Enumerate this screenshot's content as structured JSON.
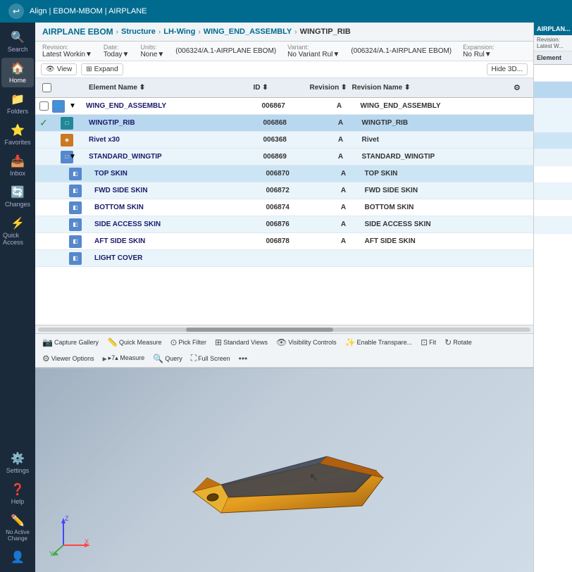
{
  "topbar": {
    "back_label": "←",
    "title": "Align | EBOM-MBOM | AIRPLANE"
  },
  "sidebar": {
    "items": [
      {
        "id": "search",
        "icon": "🔍",
        "label": "Search"
      },
      {
        "id": "home",
        "icon": "🏠",
        "label": "Home"
      },
      {
        "id": "folders",
        "icon": "📁",
        "label": "Folders"
      },
      {
        "id": "favorites",
        "icon": "⭐",
        "label": "Favorites"
      },
      {
        "id": "inbox",
        "icon": "📥",
        "label": "Inbox"
      },
      {
        "id": "changes",
        "icon": "🔄",
        "label": "Changes"
      },
      {
        "id": "quick-access",
        "icon": "⚡",
        "label": "Quick Access"
      }
    ],
    "bottom_items": [
      {
        "id": "settings",
        "icon": "⚙️",
        "label": "Settings"
      },
      {
        "id": "help",
        "icon": "❓",
        "label": "Help"
      },
      {
        "id": "no-active-change",
        "icon": "✏️",
        "label": "No Active Change"
      },
      {
        "id": "user",
        "icon": "👤",
        "label": "User"
      }
    ]
  },
  "ebom": {
    "title": "AIRPLANE EBOM",
    "breadcrumb": [
      "Structure",
      "LH-Wing",
      "WING_END_ASSEMBLY",
      "WINGTIP_RIB"
    ],
    "revision_bar": {
      "revision_label": "Revision:",
      "revision_val": "Latest Workin▼",
      "date_label": "Date:",
      "date_val": "Today▼",
      "units_label": "Units:",
      "units_val": "None▼",
      "ebom_label": "(006324/A.1-AIRPLANE EBOM)",
      "variant_label": "Variant:",
      "variant_val": "No Variant Rul▼",
      "variant2_val": "(006324/A.1-AIRPLANE EBOM)",
      "expansion_label": "Expansion:",
      "expansion_val": "No Rul▼"
    },
    "toolbar": {
      "view_label": "View",
      "expand_label": "Expand",
      "hide3d_label": "Hide 3D..."
    },
    "columns": {
      "element_name": "Element Name ⬍",
      "id": "ID ⬍",
      "revision": "Revision ⬍",
      "revision_name": "Revision Name ⬍"
    },
    "rows": [
      {
        "indent": 0,
        "checked": false,
        "icon": "globe",
        "expand": true,
        "name": "WING_END_ASSEMBLY",
        "id": "006867",
        "rev": "A",
        "rev_name": "WING_END_ASSEMBLY",
        "style": "normal"
      },
      {
        "indent": 1,
        "checked": true,
        "icon": "box",
        "expand": false,
        "name": "WINGTIP_RIB",
        "id": "006868",
        "rev": "A",
        "rev_name": "WINGTIP_RIB",
        "style": "selected"
      },
      {
        "indent": 1,
        "checked": false,
        "icon": "rivet",
        "expand": false,
        "name": "Rivet x30",
        "id": "006368",
        "rev": "A",
        "rev_name": "Rivet",
        "style": "light"
      },
      {
        "indent": 1,
        "checked": false,
        "icon": "box",
        "expand": true,
        "name": "STANDARD_WINGTIP",
        "id": "006869",
        "rev": "A",
        "rev_name": "STANDARD_WINGTIP",
        "style": "light"
      },
      {
        "indent": 2,
        "checked": false,
        "icon": "skin",
        "expand": false,
        "name": "TOP SKIN",
        "id": "006870",
        "rev": "A",
        "rev_name": "TOP SKIN",
        "style": "highlight"
      },
      {
        "indent": 2,
        "checked": false,
        "icon": "skin",
        "expand": false,
        "name": "FWD SIDE SKIN",
        "id": "006872",
        "rev": "A",
        "rev_name": "FWD SIDE SKIN",
        "style": "light"
      },
      {
        "indent": 2,
        "checked": false,
        "icon": "skin",
        "expand": false,
        "name": "BOTTOM SKIN",
        "id": "006874",
        "rev": "A",
        "rev_name": "BOTTOM SKIN",
        "style": "normal"
      },
      {
        "indent": 2,
        "checked": false,
        "icon": "skin",
        "expand": false,
        "name": "SIDE ACCESS SKIN",
        "id": "006876",
        "rev": "A",
        "rev_name": "SIDE ACCESS SKIN",
        "style": "light"
      },
      {
        "indent": 2,
        "checked": false,
        "icon": "skin",
        "expand": false,
        "name": "AFT SIDE SKIN",
        "id": "006878",
        "rev": "A",
        "rev_name": "AFT SIDE SKIN",
        "style": "normal"
      },
      {
        "indent": 2,
        "checked": false,
        "icon": "skin",
        "expand": false,
        "name": "LIGHT COVER",
        "id": "",
        "rev": "",
        "rev_name": "",
        "style": "light"
      }
    ]
  },
  "bottom_toolbar": {
    "items": [
      {
        "icon": "📷",
        "label": "Capture Gallery"
      },
      {
        "icon": "📏",
        "label": "Quick Measure"
      },
      {
        "icon": "🔽",
        "label": "Pick Filter"
      },
      {
        "icon": "📋",
        "label": "Standard Views"
      },
      {
        "icon": "👁️",
        "label": "Visibility Controls"
      },
      {
        "icon": "✨",
        "label": "Enable Transpare..."
      },
      {
        "icon": "⊞",
        "label": "Fit"
      },
      {
        "icon": "🔄",
        "label": "Rotate"
      },
      {
        "icon": "⚙️",
        "label": "Viewer Options"
      },
      {
        "icon": "📐",
        "label": "▸7▴ Measure"
      },
      {
        "icon": "🔍",
        "label": "Query"
      },
      {
        "icon": "⛶",
        "label": "Full Screen"
      },
      {
        "icon": "•••",
        "label": "More"
      }
    ]
  },
  "right_panel": {
    "title": "AIRPLAN...",
    "revision": "Revision: Latest W..."
  },
  "viewer": {
    "axis_x_label": "X",
    "axis_y_label": "Y",
    "axis_z_label": "Z"
  }
}
